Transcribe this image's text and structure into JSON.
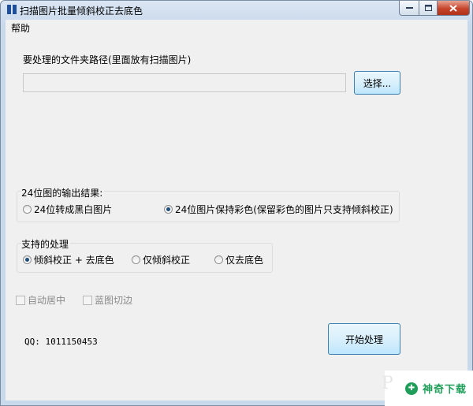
{
  "window": {
    "title": "扫描图片批量倾斜校正去底色",
    "icon": "app-book-icon"
  },
  "menu": {
    "help": "帮助"
  },
  "folder": {
    "label": "要处理的文件夹路径(里面放有扫描图片)",
    "path_value": "",
    "select_button": "选择..."
  },
  "output_24bit": {
    "label": "24位图的输出结果:",
    "options": [
      {
        "label": "24位转成黑白图片",
        "checked": false
      },
      {
        "label": "24位图片保持彩色(保留彩色的图片只支持倾斜校正)",
        "checked": true
      }
    ]
  },
  "processing": {
    "label": "支持的处理",
    "options": [
      {
        "label": "倾斜校正 + 去底色",
        "checked": true
      },
      {
        "label": "仅倾斜校正",
        "checked": false
      },
      {
        "label": "仅去底色",
        "checked": false
      }
    ]
  },
  "checkboxes": {
    "auto_center": {
      "label": "自动居中",
      "checked": false,
      "enabled": false
    },
    "blue_crop": {
      "label": "蓝图切边",
      "checked": false,
      "enabled": false
    }
  },
  "qq": "QQ: 1011150453",
  "start_button": "开始处理",
  "watermark": {
    "text": "神奇下载",
    "letter": "P"
  },
  "colors": {
    "accent": "#3c7fb1",
    "close": "#c7442a",
    "watermark": "#1f9e5a"
  }
}
